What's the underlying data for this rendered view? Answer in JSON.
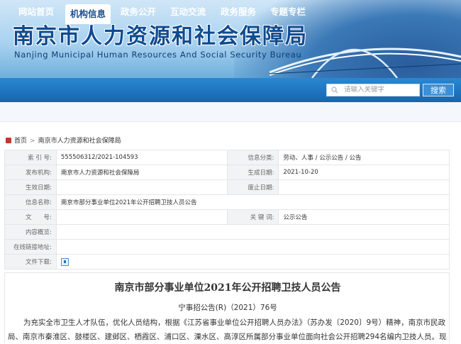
{
  "header": {
    "title_cn": "南京市人力资源和社会保障局",
    "title_en": "Nanjing Municipal Human Resources And Social Security Bureau"
  },
  "nav": {
    "items": [
      {
        "label": "网站首页"
      },
      {
        "label": "机构信息",
        "active": true
      },
      {
        "label": "政务公开"
      },
      {
        "label": "互动交流"
      },
      {
        "label": "政务服务"
      },
      {
        "label": "专题专栏"
      }
    ],
    "search_placeholder": "请输入关键字",
    "search_button": "搜索"
  },
  "breadcrumb": {
    "home": "首页",
    "separator": ">",
    "current": "南京市人力资源和社会保障局"
  },
  "info": {
    "index_label": "索 引 号:",
    "index_value": "555506312/2021-104593",
    "category_label": "信息分类:",
    "category_value": "劳动、人事 / 公示公告 / 公告",
    "publisher_label": "发布机构:",
    "publisher_value": "南京市人力资源和社会保障局",
    "created_label": "生成日期:",
    "created_value": "2021-10-20",
    "effective_label": "生效日期:",
    "effective_value": "",
    "repeal_label": "废止日期:",
    "repeal_value": "",
    "name_label": "信息名称:",
    "name_value": "南京市部分事业单位2021年公开招聘卫技人员公告",
    "docno_label": "文　　号:",
    "docno_value": "",
    "keyword_label": "关 键 词:",
    "keyword_value": "公示公告",
    "overview_label": "内容概览:",
    "overview_value": "",
    "online_label": "在线链接地址:",
    "online_value": "",
    "download_label": "文件下载:"
  },
  "article": {
    "title": "南京市部分事业单位2021年公开招聘卫技人员公告",
    "doc_number": "宁事招公告(R)（2021）76号",
    "body": "为充实全市卫生人才队伍，优化人员结构，根据《江苏省事业单位公开招聘人员办法》（苏办发〔2020〕9号）精神，南京市民政局、南京市秦淮区、鼓楼区、建邺区、栖霞区、浦口区、溧水区、高淳区所属部分事业单位面向社会公开招聘294名编内卫技人员。现"
  },
  "colors": {
    "nav_bg": "#1566b0",
    "title_blue": "#0f4b8f",
    "search_btn": "#3c8fd6"
  }
}
